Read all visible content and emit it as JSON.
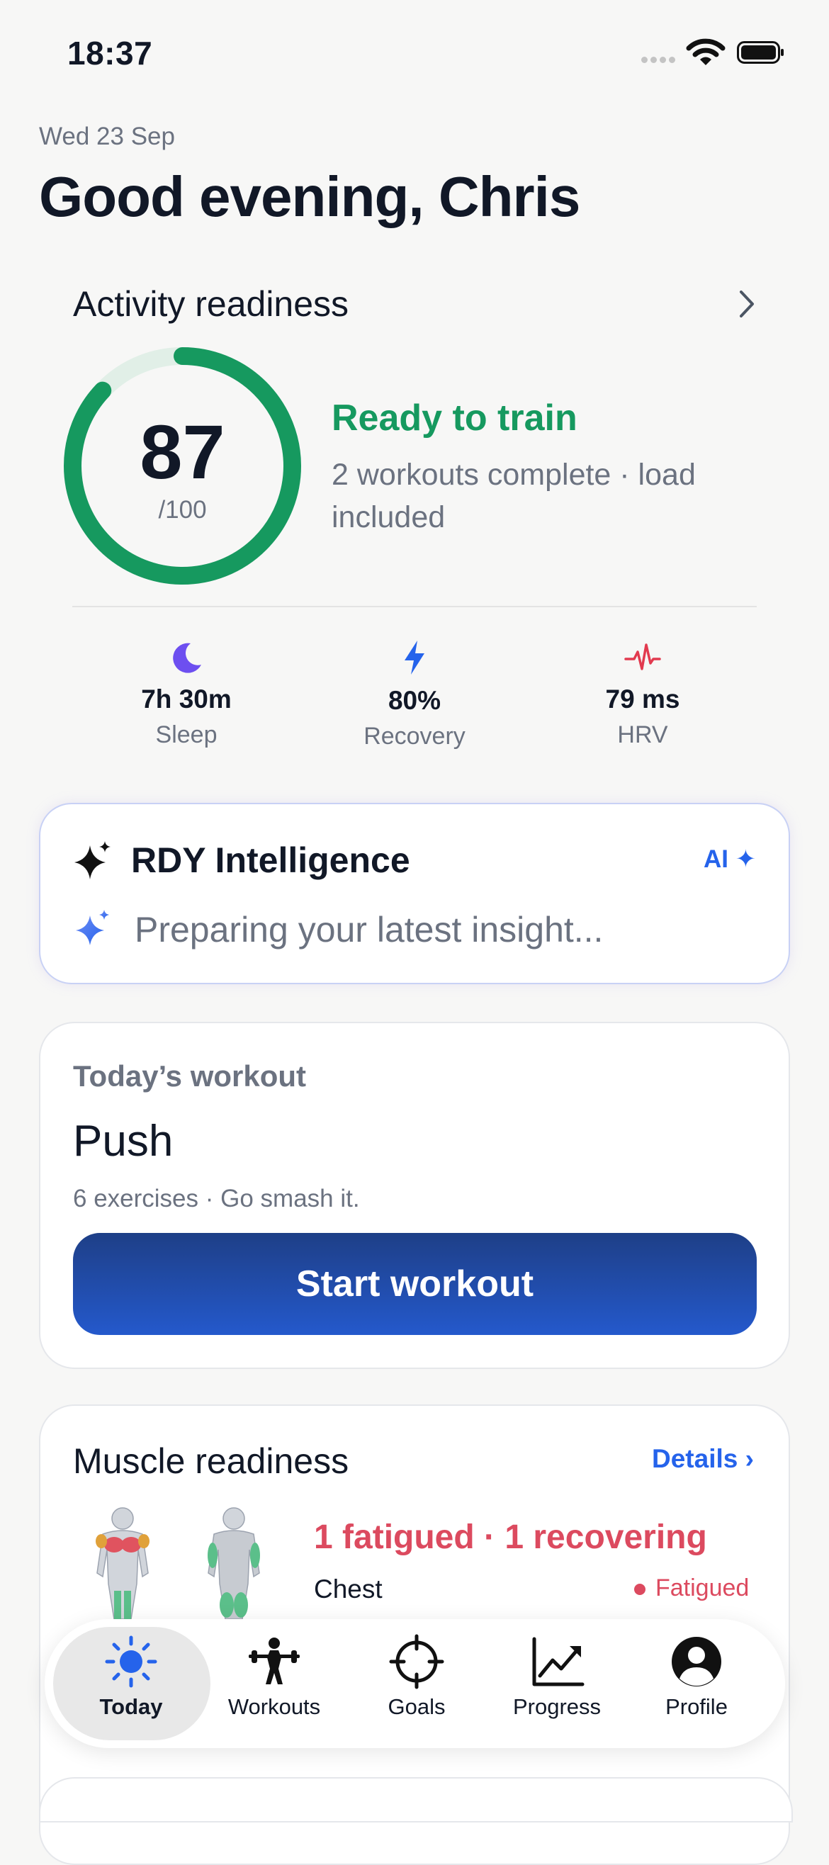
{
  "status_bar": {
    "time": "18:37"
  },
  "header": {
    "date": "Wed 23 Sep",
    "greeting": "Good evening, Chris"
  },
  "activity_readiness": {
    "title": "Activity readiness",
    "score": "87",
    "score_max": "/100",
    "score_fraction": 0.87,
    "status": "Ready to train",
    "subtitle": "2 workouts complete · load included",
    "metrics": [
      {
        "icon": "moon-icon",
        "value": "7h 30m",
        "label": "Sleep",
        "color": "#6d4ff0"
      },
      {
        "icon": "bolt-icon",
        "value": "80%",
        "label": "Recovery",
        "color": "#2563eb"
      },
      {
        "icon": "heartbeat-icon",
        "value": "79 ms",
        "label": "HRV",
        "color": "#e23a4f"
      }
    ]
  },
  "ai_card": {
    "title": "RDY Intelligence",
    "badge": "AI ✦",
    "message": "Preparing your latest insight..."
  },
  "todays_workout": {
    "label": "Today’s workout",
    "name": "Push",
    "subtitle": "6 exercises · Go smash it.",
    "button": "Start workout"
  },
  "muscle_readiness": {
    "title": "Muscle readiness",
    "details_link": "Details ›",
    "summary": "1 fatigued · 1 recovering",
    "rows": [
      {
        "name": "Chest",
        "status": "Fatigued"
      }
    ]
  },
  "tab_bar": {
    "tabs": [
      {
        "label": "Today",
        "icon": "sun-icon",
        "active": true
      },
      {
        "label": "Workouts",
        "icon": "weightlifter-icon",
        "active": false
      },
      {
        "label": "Goals",
        "icon": "crosshair-icon",
        "active": false
      },
      {
        "label": "Progress",
        "icon": "trend-chart-icon",
        "active": false
      },
      {
        "label": "Profile",
        "icon": "person-icon",
        "active": false
      }
    ]
  },
  "colors": {
    "accent_green": "#16995f",
    "accent_blue": "#2563eb",
    "fatigued_red": "#dc4a5f",
    "button_gradient_top": "#1e3f87",
    "button_gradient_bottom": "#2459cc"
  }
}
